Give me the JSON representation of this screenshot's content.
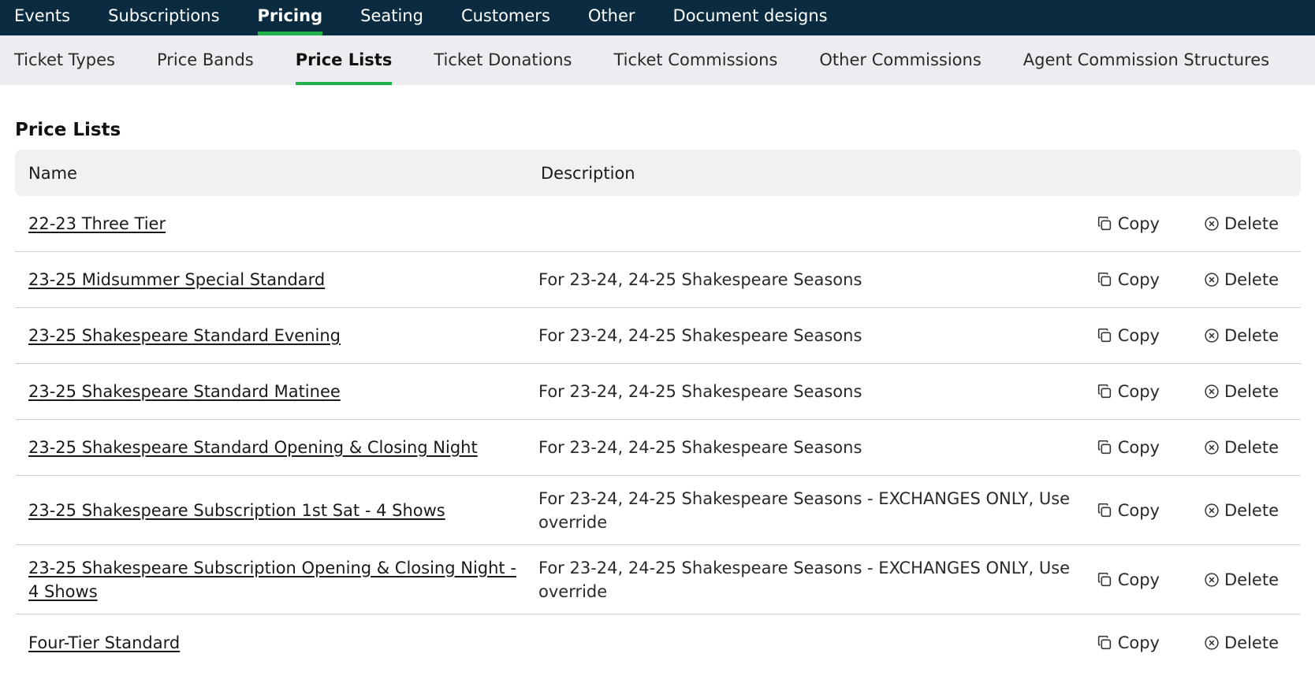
{
  "topnav": [
    {
      "label": "Events",
      "active": false
    },
    {
      "label": "Subscriptions",
      "active": false
    },
    {
      "label": "Pricing",
      "active": true
    },
    {
      "label": "Seating",
      "active": false
    },
    {
      "label": "Customers",
      "active": false
    },
    {
      "label": "Other",
      "active": false
    },
    {
      "label": "Document designs",
      "active": false
    }
  ],
  "subnav": [
    {
      "label": "Ticket Types",
      "active": false
    },
    {
      "label": "Price Bands",
      "active": false
    },
    {
      "label": "Price Lists",
      "active": true
    },
    {
      "label": "Ticket Donations",
      "active": false
    },
    {
      "label": "Ticket Commissions",
      "active": false
    },
    {
      "label": "Other Commissions",
      "active": false
    },
    {
      "label": "Agent Commission Structures",
      "active": false
    }
  ],
  "page": {
    "title": "Price Lists"
  },
  "table": {
    "headers": {
      "name": "Name",
      "description": "Description"
    },
    "actions": {
      "copy": "Copy",
      "delete": "Delete"
    },
    "rows": [
      {
        "name": "22-23 Three Tier",
        "description": ""
      },
      {
        "name": "23-25 Midsummer Special Standard",
        "description": "For 23-24, 24-25 Shakespeare Seasons"
      },
      {
        "name": "23-25 Shakespeare Standard Evening",
        "description": "For 23-24, 24-25 Shakespeare Seasons"
      },
      {
        "name": "23-25 Shakespeare Standard Matinee",
        "description": "For 23-24, 24-25 Shakespeare Seasons"
      },
      {
        "name": "23-25 Shakespeare Standard Opening & Closing Night",
        "description": "For 23-24, 24-25 Shakespeare Seasons"
      },
      {
        "name": "23-25 Shakespeare Subscription 1st Sat - 4 Shows",
        "description": "For 23-24, 24-25 Shakespeare Seasons - EXCHANGES ONLY, Use override"
      },
      {
        "name": "23-25 Shakespeare Subscription Opening & Closing Night - 4 Shows",
        "description": "For 23-24, 24-25 Shakespeare Seasons - EXCHANGES ONLY, Use override"
      },
      {
        "name": "Four-Tier Standard",
        "description": ""
      }
    ]
  },
  "colors": {
    "nav_bg": "#0b2c40",
    "accent": "#22b04b",
    "subnav_bg": "#ebedf0",
    "header_bg": "#f1f1f1"
  },
  "icons": {
    "copy": "copy-icon",
    "delete": "delete-circle-x-icon"
  }
}
